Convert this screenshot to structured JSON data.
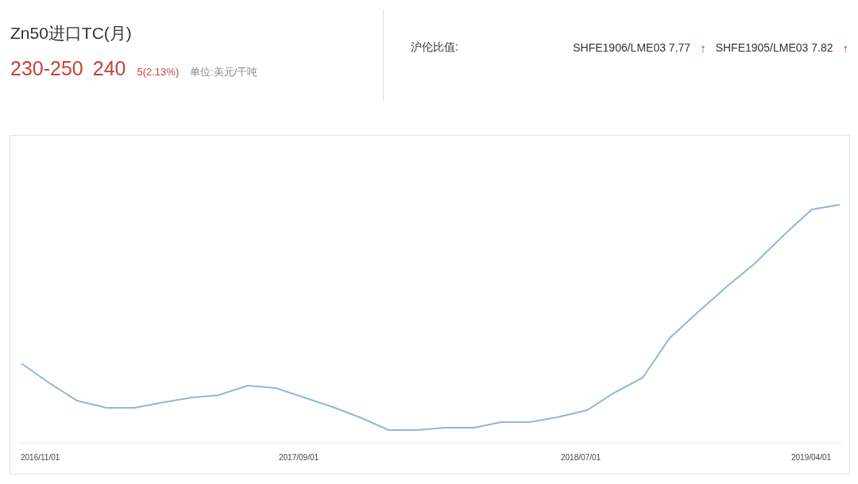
{
  "title": "Zn50进口TC(月)",
  "quote": {
    "range": "230-250",
    "price": "240",
    "change": "5(2.13%)",
    "unit": "单位:美元/干吨"
  },
  "ratio": {
    "label": "沪伦比值:",
    "items": [
      {
        "text": "SHFE1906/LME03 7.77",
        "arrow": "↑"
      },
      {
        "text": "SHFE1905/LME03 7.82",
        "arrow": "↑"
      }
    ]
  },
  "chart": {
    "x_labels": [
      "2016/11/01",
      "2017/09/01",
      "2018/07/01",
      "2019/04/01"
    ]
  }
}
